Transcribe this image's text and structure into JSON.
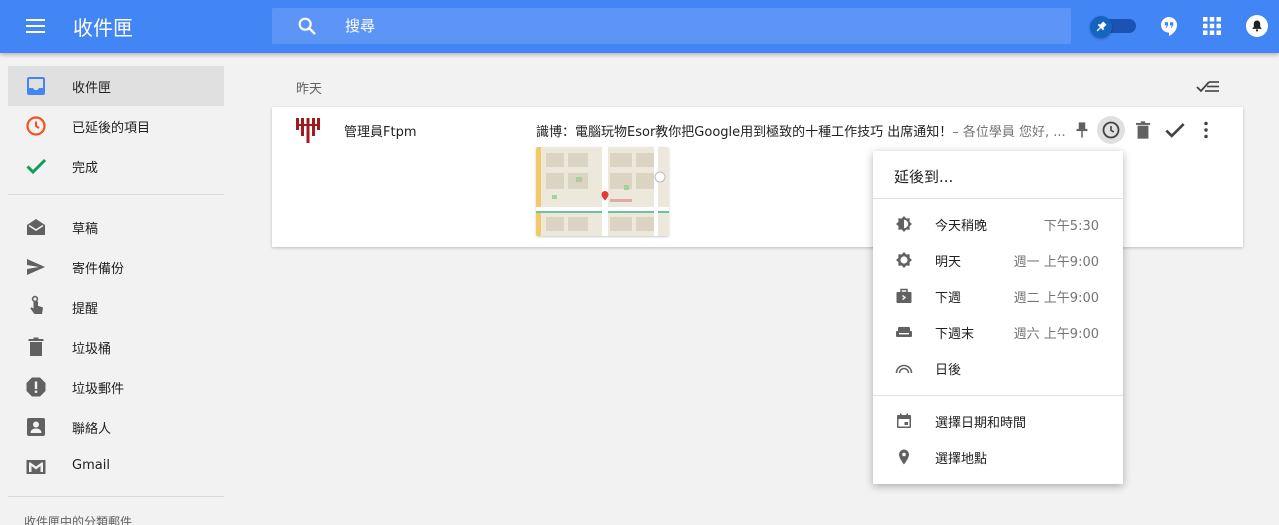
{
  "header": {
    "title": "收件匣",
    "search_placeholder": "搜尋"
  },
  "sidebar": {
    "items": [
      {
        "label": "收件匣"
      },
      {
        "label": "已延後的項目"
      },
      {
        "label": "完成"
      },
      {
        "label": "草稿"
      },
      {
        "label": "寄件備份"
      },
      {
        "label": "提醒"
      },
      {
        "label": "垃圾桶"
      },
      {
        "label": "垃圾郵件"
      },
      {
        "label": "聯絡人"
      },
      {
        "label": "Gmail"
      }
    ],
    "section_label": "收件匣中的分類郵件"
  },
  "main": {
    "day_label": "昨天",
    "email": {
      "sender": "管理員Ftpm",
      "subject": "識博：電腦玩物Esor教你把Google用到極致的十種工作技巧 出席通知！",
      "snippet": "– 各位學員 您好, ..."
    }
  },
  "snooze_menu": {
    "title": "延後到...",
    "options": [
      {
        "label": "今天稍晚",
        "time": "下午5:30",
        "icon": "later-today-icon"
      },
      {
        "label": "明天",
        "time": "週一 上午9:00",
        "icon": "tomorrow-sun-icon"
      },
      {
        "label": "下週",
        "time": "週二 上午9:00",
        "icon": "briefcase-icon"
      },
      {
        "label": "下週末",
        "time": "週六 上午9:00",
        "icon": "sofa-icon"
      },
      {
        "label": "日後",
        "time": "",
        "icon": "rainbow-icon"
      }
    ],
    "extra": [
      {
        "label": "選擇日期和時間",
        "icon": "calendar-icon"
      },
      {
        "label": "選擇地點",
        "icon": "location-pin-icon"
      }
    ]
  },
  "colors": {
    "brand_blue": "#4285f4",
    "search_bg": "#5c95f5",
    "inbox_icon": "#4285f4",
    "snoozed_icon": "#f4511e",
    "done_icon": "#0f9d58",
    "logo_red": "#a01a1e"
  }
}
